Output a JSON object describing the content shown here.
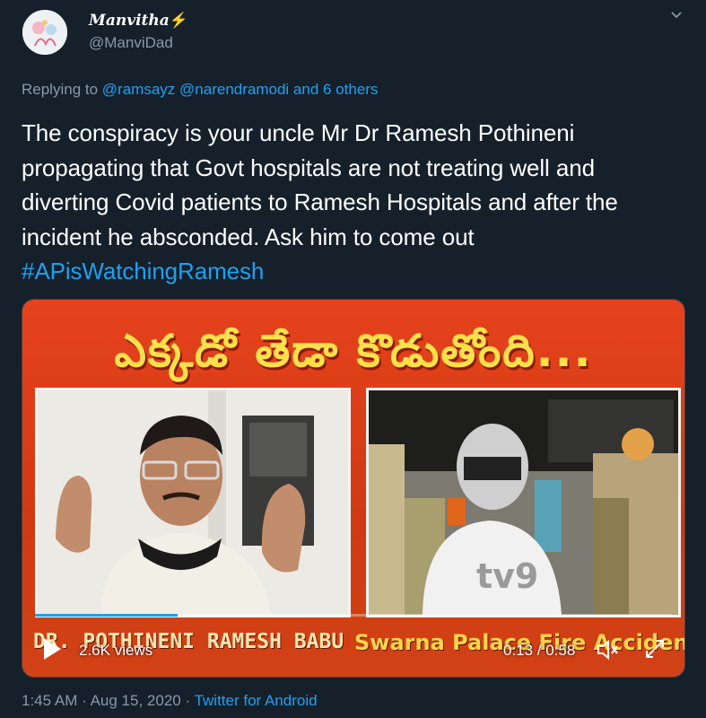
{
  "author": {
    "display_name": "Manvitha",
    "badge": "⚡",
    "handle": "@ManviDad"
  },
  "reply": {
    "prefix": "Replying to",
    "mention_1": "@ramsayz",
    "mention_2": "@narendramodi",
    "others": "and 6 others"
  },
  "tweet": {
    "text": "The conspiracy is your uncle Mr Dr Ramesh Pothineni propagating that Govt hospitals are not treating well and diverting Covid patients to Ramesh Hospitals and after the incident he absconded. Ask him to come out",
    "hashtag": "#APisWatchingRamesh"
  },
  "media": {
    "headline": "ఎక్కడో తేడా కొడుతోంది...",
    "caption_left": "DR. POTHINENI RAMESH BABU",
    "caption_right": "Swarna Palace Fire Accident",
    "views": "2.6K views",
    "time": "0:13 / 0:58",
    "progress_fraction": 0.224
  },
  "meta": {
    "time": "1:45 AM",
    "sep1": "·",
    "date": "Aug 15, 2020",
    "sep2": "·",
    "source": "Twitter for Android"
  },
  "colors": {
    "background": "#15202b",
    "accent": "#1da1f2",
    "muted": "#8899a6",
    "media_red": "#e5421d",
    "headline_yellow": "#ffe04a"
  },
  "icons": [
    "caret-down-icon",
    "play-icon",
    "volume-icon",
    "fullscreen-icon",
    "lightning-icon"
  ]
}
